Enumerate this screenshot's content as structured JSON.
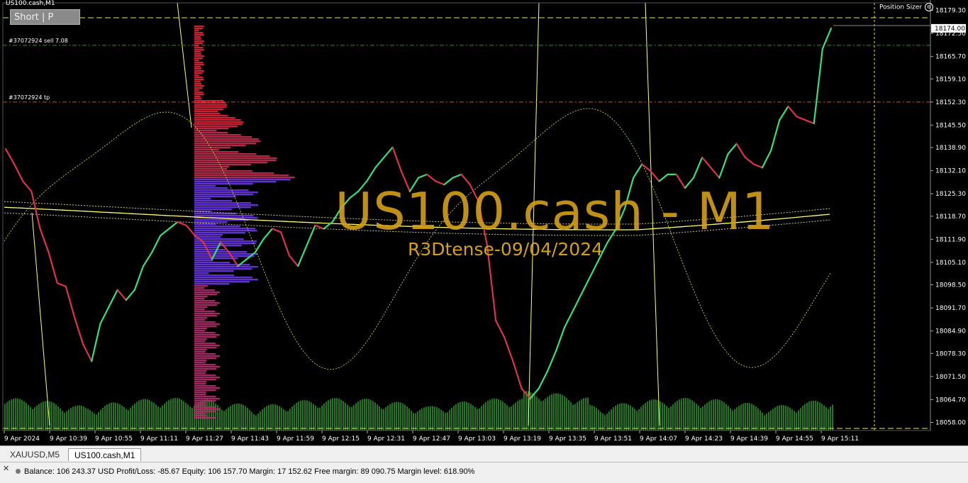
{
  "window": {
    "title": "US100.cash,M1",
    "short_panel": "Short | P",
    "position_sizer": "Position Sizer"
  },
  "orders": {
    "sell_label": "#37072924 sell 7.08",
    "tp_label": "#37072924 tp"
  },
  "watermark": {
    "title": "US100.cash - M1",
    "subtitle": "R3Dtense-09/04/2024"
  },
  "price_axis": {
    "ticks": [
      "18179.30",
      "18172.50",
      "18165.70",
      "18159.10",
      "18152.30",
      "18145.50",
      "18138.90",
      "18132.10",
      "18125.30",
      "18118.70",
      "18111.90",
      "18105.10",
      "18098.50",
      "18091.70",
      "18084.90",
      "18078.30",
      "18071.50",
      "18064.70",
      "18058.00"
    ],
    "current_price": "18174.00",
    "current_color": "#ffffff"
  },
  "time_axis": {
    "labels": [
      "9 Apr 2024",
      "9 Apr 10:39",
      "9 Apr 10:55",
      "9 Apr 11:11",
      "9 Apr 11:27",
      "9 Apr 11:43",
      "9 Apr 11:59",
      "9 Apr 12:15",
      "9 Apr 12:31",
      "9 Apr 12:47",
      "9 Apr 13:03",
      "9 Apr 13:19",
      "9 Apr 13:35",
      "9 Apr 13:51",
      "9 Apr 14:07",
      "9 Apr 14:23",
      "9 Apr 14:39",
      "9 Apr 14:55",
      "9 Apr 15:11"
    ]
  },
  "tabs": [
    {
      "label": "XAUUSD,M5",
      "active": false
    },
    {
      "label": "US100.cash,M1",
      "active": true
    }
  ],
  "status": {
    "text": "Balance: 106 243.37 USD  Profit/Loss: -85.67  Equity: 106 157.70  Margin: 17 152.62  Free margin: 89 090.75  Margin level: 618.90%"
  },
  "colors": {
    "background": "#000000",
    "bull": "#33e07a",
    "bear": "#e0304a",
    "band": "#ffff66",
    "watermark": "#d4a017",
    "sell_line": "#1aa31a",
    "tp_line": "#d0502a",
    "volume": "#1f7a1f"
  },
  "chart_data": {
    "type": "line",
    "title": "US100.cash - M1",
    "subtitle": "R3Dtense-09/04/2024",
    "x_labels": [
      "9 Apr 2024",
      "9 Apr 10:39",
      "9 Apr 10:55",
      "9 Apr 11:11",
      "9 Apr 11:27",
      "9 Apr 11:43",
      "9 Apr 11:59",
      "9 Apr 12:15",
      "9 Apr 12:31",
      "9 Apr 12:47",
      "9 Apr 13:03",
      "9 Apr 13:19",
      "9 Apr 13:35",
      "9 Apr 13:51",
      "9 Apr 14:07",
      "9 Apr 14:23",
      "9 Apr 14:39",
      "9 Apr 14:55",
      "9 Apr 15:11"
    ],
    "ylim": [
      18055.6,
      18181.5
    ],
    "series": [
      {
        "values": [
          18138.5,
          18134,
          18129,
          18126,
          18115,
          18108,
          18099,
          18098,
          18089,
          18081,
          18076,
          18087,
          18092,
          18097,
          18094,
          18097,
          18104,
          18108,
          18113,
          18115,
          18117,
          18116,
          18113,
          18111,
          18106,
          18111,
          18108,
          18104,
          18106,
          18108,
          18112,
          18115,
          18114,
          18107,
          18104,
          18110,
          18116,
          18115,
          18117,
          18121,
          18124,
          18126,
          18129,
          18133,
          18136,
          18139,
          18132,
          18126,
          18130,
          18131,
          18129,
          18128,
          18130,
          18131,
          18128,
          18123,
          18110,
          18088,
          18083,
          18076,
          18068,
          18065,
          18068,
          18073,
          18079,
          18086,
          18091,
          18096,
          18101,
          18106,
          18111,
          18115,
          18121,
          18130,
          18134,
          18132,
          18129,
          18131,
          18131,
          18127,
          18130,
          18136,
          18133,
          18130,
          18137,
          18140,
          18136,
          18134,
          18133,
          18138,
          18147,
          18151,
          18148,
          18147,
          18146,
          18168,
          18174
        ]
      },
      {
        "name": "volume profile",
        "values": []
      }
    ],
    "horizontal_lines": [
      {
        "label": "#37072924 sell 7.08",
        "price": 18169.0
      },
      {
        "label": "#37072924 tp",
        "price": 18152.3
      }
    ],
    "current_price": 18174.0,
    "grid": false
  }
}
